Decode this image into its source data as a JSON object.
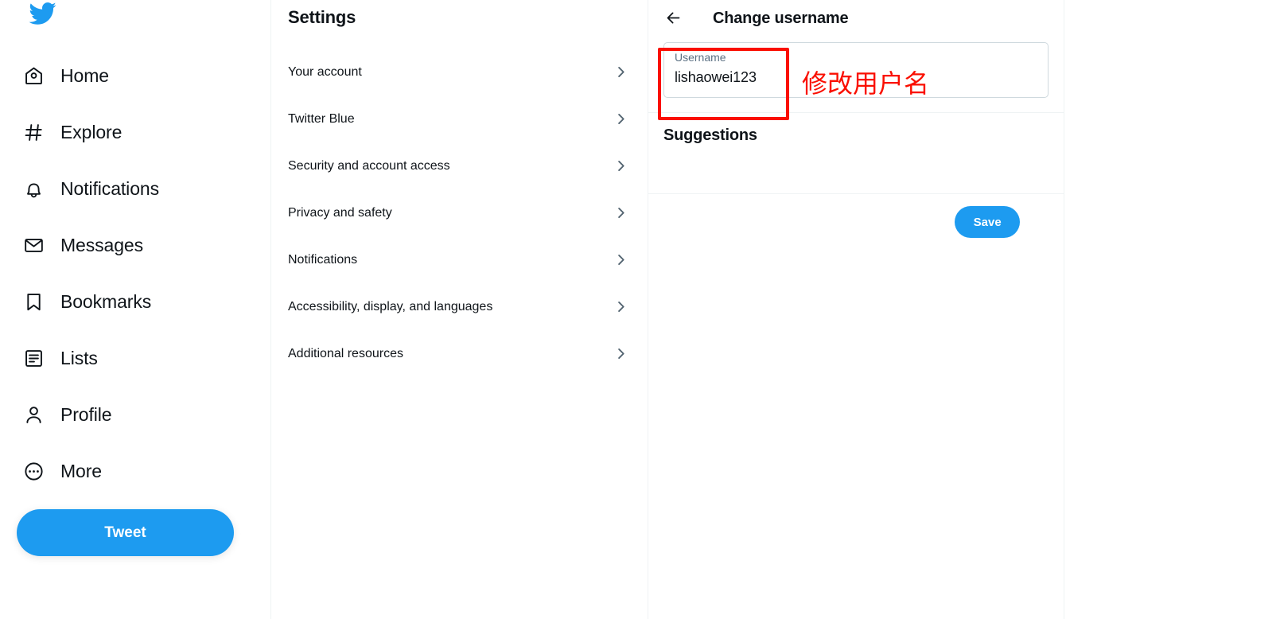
{
  "brand": {
    "logo_icon": "twitter-bird-icon",
    "accent_color": "#1d9bf0",
    "text_color": "#0f1419",
    "muted_color": "#5b7083",
    "border_color": "#eff3f4",
    "annotation_color": "#fa0f00"
  },
  "sidebar": {
    "items": [
      {
        "label": "Home",
        "icon": "home-icon"
      },
      {
        "label": "Explore",
        "icon": "hashtag-icon"
      },
      {
        "label": "Notifications",
        "icon": "bell-icon"
      },
      {
        "label": "Messages",
        "icon": "envelope-icon"
      },
      {
        "label": "Bookmarks",
        "icon": "bookmark-icon"
      },
      {
        "label": "Lists",
        "icon": "list-icon"
      },
      {
        "label": "Profile",
        "icon": "person-icon"
      },
      {
        "label": "More",
        "icon": "more-ellipsis-icon"
      }
    ],
    "tweet_button": "Tweet"
  },
  "settings": {
    "title": "Settings",
    "items": [
      {
        "label": "Your account"
      },
      {
        "label": "Twitter Blue"
      },
      {
        "label": "Security and account access"
      },
      {
        "label": "Privacy and safety"
      },
      {
        "label": "Notifications"
      },
      {
        "label": "Accessibility, display, and languages"
      },
      {
        "label": "Additional resources"
      }
    ],
    "chevron_icon": "chevron-right-icon"
  },
  "detail": {
    "back_icon": "arrow-left-icon",
    "title": "Change username",
    "username_field": {
      "label": "Username",
      "value": "lishaowei123"
    },
    "suggestions_title": "Suggestions",
    "save_label": "Save"
  },
  "annotation": {
    "text": "修改用户名",
    "highlight_target": "username-field"
  }
}
